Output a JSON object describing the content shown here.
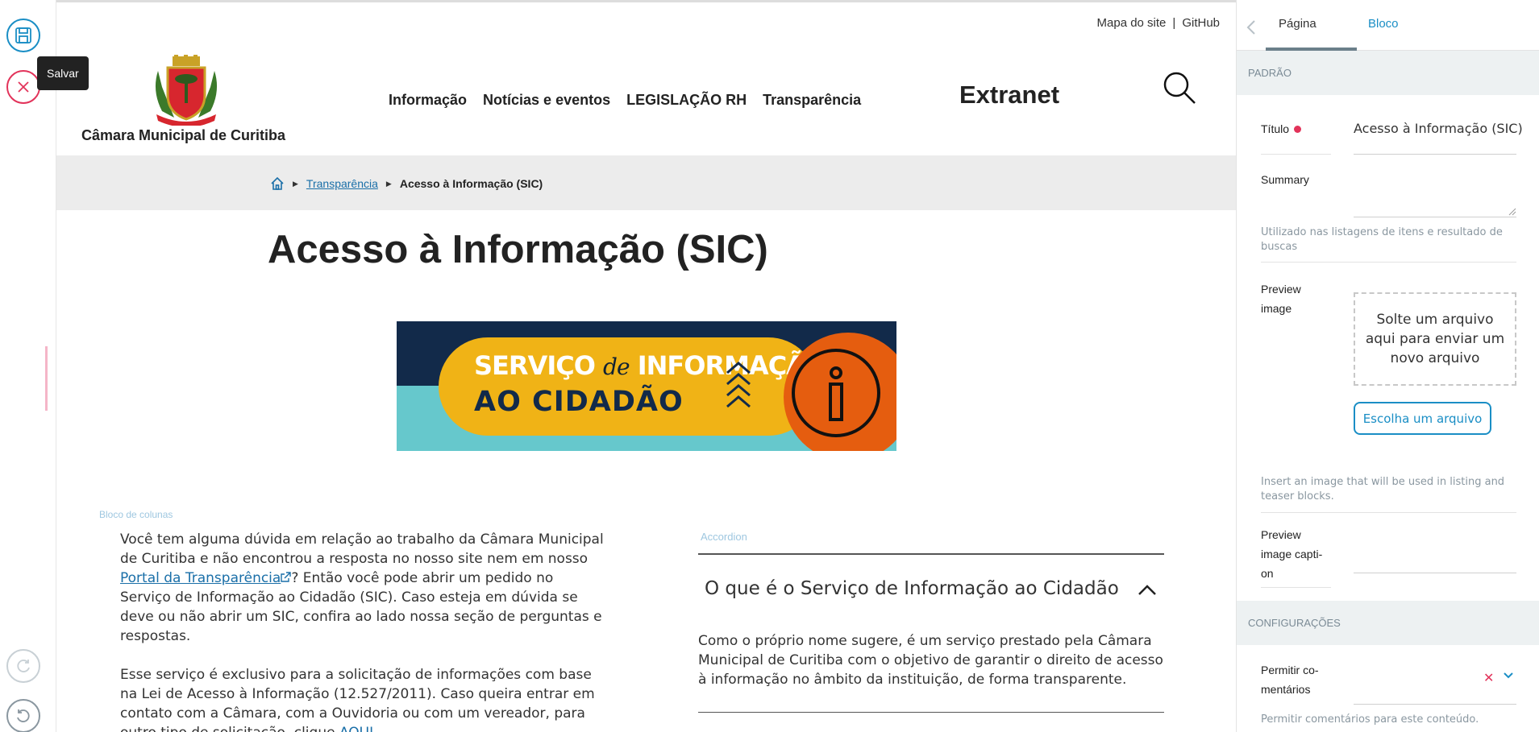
{
  "toolbar": {
    "save_tooltip": "Salvar"
  },
  "header": {
    "top_links": [
      "Mapa do site",
      "GitHub"
    ],
    "separator": "|",
    "org_name": "Câmara Municipal de Curitiba",
    "nav": [
      "Informação",
      "Notícias e eventos",
      "LEGISLAÇÃO RH",
      "Transparência"
    ],
    "extranet": "Extranet"
  },
  "breadcrumb": {
    "parent": "Transparência",
    "current": "Acesso à Informação (SIC)"
  },
  "page": {
    "title": "Acesso à Informação (SIC)",
    "banner": {
      "line1_a": "SERVIÇO",
      "line1_de": "de",
      "line1_b": "INFORMAÇÃO",
      "line2": "AO CIDADÃO"
    },
    "columns_label": "Bloco de colunas",
    "left_p1_a": "Você tem alguma dúvida em relação ao trabalho da Câmara Municipal de Curitiba e não encontrou a resposta no nosso site nem em nosso ",
    "left_p1_link": "Portal da Transparência",
    "left_p1_b": "? Então você pode abrir um pedido no Serviço de Informação ao Cidadão (SIC). Caso esteja em dúvida se deve ou não abrir um SIC, confira ao lado nossa seção de perguntas e respostas.",
    "left_p2_a": "Esse serviço é exclusivo para a solicitação de informações com base na Lei de Acesso à Informação (12.527/2011). Caso queira entrar em contato com a Câmara, com a Ouvidoria ou com um vereador, para outro tipo de solicitação, clique ",
    "left_p2_link": "AQUI",
    "accordion_label": "Accordion",
    "accordion_title": "O que é o Serviço de Informação ao Cidadão",
    "accordion_body": "Como o próprio nome sugere, é um serviço prestado pela Câmara Municipal de Curitiba com o objetivo de garantir o direito de acesso à informação no âmbito da instituição, de forma transparente."
  },
  "sidebar": {
    "tabs": [
      "Página",
      "Bloco"
    ],
    "section_default": "PADRÃO",
    "title_label": "Título",
    "title_value": "Acesso à Informação (SIC)",
    "summary_label": "Summary",
    "summary_help": "Utilizado nas listagens de itens e resultado de buscas",
    "preview_label": "Preview image",
    "dropzone_text": "Solte um arquivo aqui para enviar um novo arquivo",
    "choose_button": "Escolha um arquivo",
    "preview_help": "Insert an image that will be used in listing and teaser blocks.",
    "caption_label": "Preview image capti-on",
    "section_settings": "CONFIGURAÇÕES",
    "comments_label": "Permitir co-mentários",
    "comments_help": "Permitir comentários para este conteúdo."
  },
  "colors": {
    "accent": "#1a8ec5",
    "danger": "#e2335a",
    "banner_navy": "#122a4a",
    "banner_yellow": "#f0b316",
    "banner_orange": "#e55d0f",
    "banner_teal": "#66c8cc"
  }
}
